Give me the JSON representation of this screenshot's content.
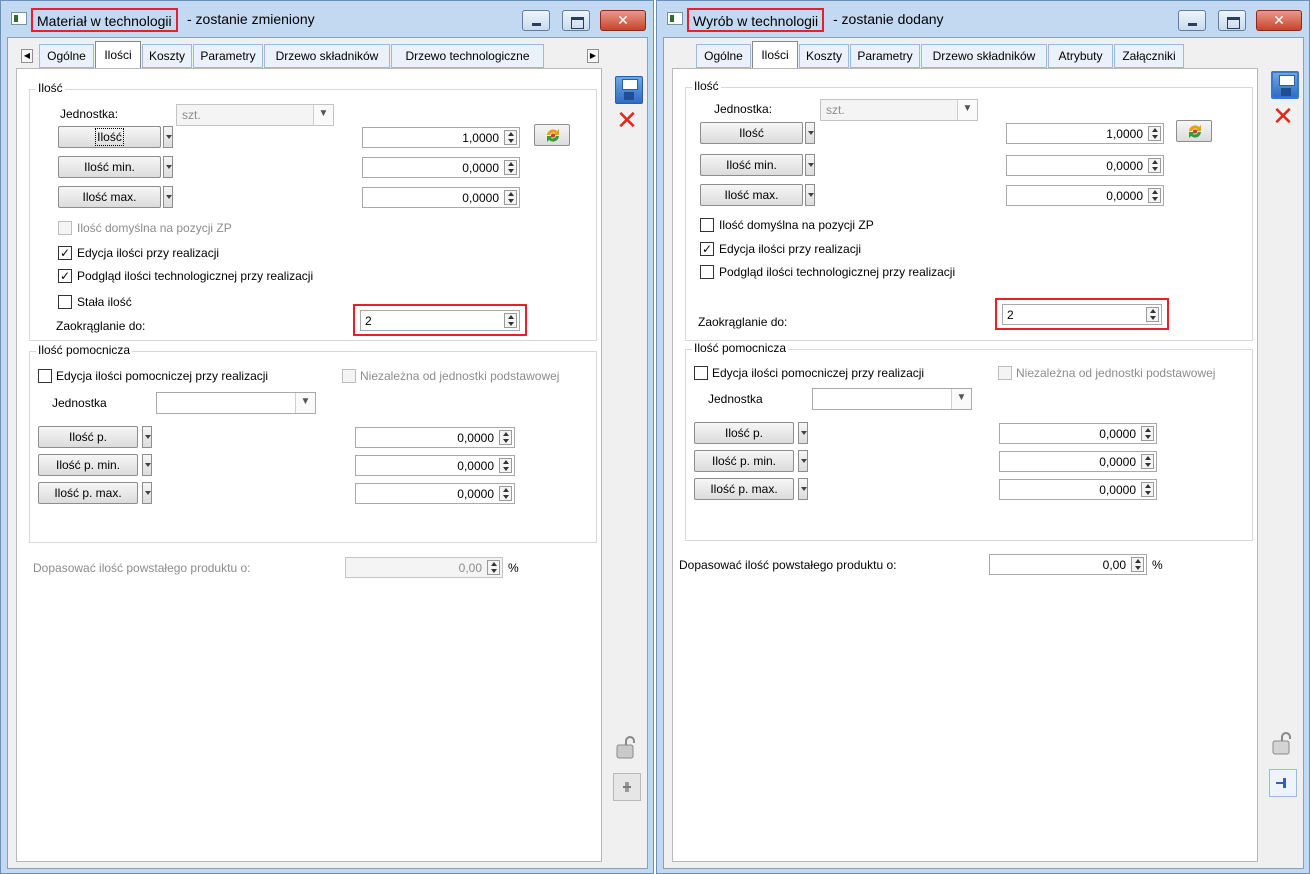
{
  "left": {
    "title": "Materiał w technologii",
    "title_suffix": " - zostanie zmieniony",
    "tabs": [
      "Ogólne",
      "Ilości",
      "Koszty",
      "Parametry",
      "Drzewo składników",
      "Drzewo technologiczne"
    ],
    "qty_group": {
      "title": "Ilość",
      "unit_label": "Jednostka:",
      "unit_value": "szt.",
      "qty_button": "Ilość",
      "qty_value": "1,0000",
      "min_button": "Ilość min.",
      "min_value": "0,0000",
      "max_button": "Ilość max.",
      "max_value": "0,0000",
      "default_on_zp_label": "Ilość domyślna na pozycji ZP",
      "edit_on_realization_label": "Edycja ilości przy realizacji",
      "preview_tech_label": "Podgląd ilości technologicznej przy realizacji",
      "fixed_qty_label": "Stała ilość",
      "rounding_label": "Zaokrąglanie do:",
      "rounding_value": "2"
    },
    "aux_group": {
      "title": "Ilość pomocnicza",
      "edit_aux_label": "Edycja ilości pomocniczej przy realizacji",
      "independent_label": "Niezależna od jednostki podstawowej",
      "unit_label": "Jednostka",
      "unit_value": "",
      "p_button": "Ilość p.",
      "p_value": "0,0000",
      "p_min_button": "Ilość p. min.",
      "p_min_value": "0,0000",
      "p_max_button": "Ilość p. max.",
      "p_max_value": "0,0000"
    },
    "adjust_label": "Dopasować ilość powstałego produktu o:",
    "adjust_value": "0,00",
    "adjust_unit": "%"
  },
  "right": {
    "title": "Wyrób w technologii",
    "title_suffix": " - zostanie dodany",
    "tabs": [
      "Ogólne",
      "Ilości",
      "Koszty",
      "Parametry",
      "Drzewo składników",
      "Atrybuty",
      "Załączniki"
    ],
    "qty_group": {
      "title": "Ilość",
      "unit_label": "Jednostka:",
      "unit_value": "szt.",
      "qty_button": "Ilość",
      "qty_value": "1,0000",
      "min_button": "Ilość min.",
      "min_value": "0,0000",
      "max_button": "Ilość max.",
      "max_value": "0,0000",
      "default_on_zp_label": "Ilość domyślna na pozycji ZP",
      "edit_on_realization_label": "Edycja ilości przy realizacji",
      "preview_tech_label": "Podgląd ilości technologicznej przy realizacji",
      "rounding_label": "Zaokrąglanie do:",
      "rounding_value": "2"
    },
    "aux_group": {
      "title": "Ilość pomocnicza",
      "edit_aux_label": "Edycja ilości pomocniczej przy realizacji",
      "independent_label": "Niezależna od jednostki podstawowej",
      "unit_label": "Jednostka",
      "unit_value": "",
      "p_button": "Ilość p.",
      "p_value": "0,0000",
      "p_min_button": "Ilość p. min.",
      "p_min_value": "0,0000",
      "p_max_button": "Ilość p. max.",
      "p_max_value": "0,0000"
    },
    "adjust_label": "Dopasować ilość powstałego produktu o:",
    "adjust_value": "0,00",
    "adjust_unit": "%"
  },
  "icons": {
    "save": "save-icon",
    "cancel": "cancel-icon",
    "lock": "lock-open-icon",
    "pin": "pin-icon",
    "refresh": "refresh-icon",
    "checkmark": "✓"
  },
  "colors": {
    "highlight": "#e8202a",
    "window_frame": "#c3d9f1",
    "tab_inactive": "#eaf1fb",
    "close_button": "#c8442f"
  }
}
